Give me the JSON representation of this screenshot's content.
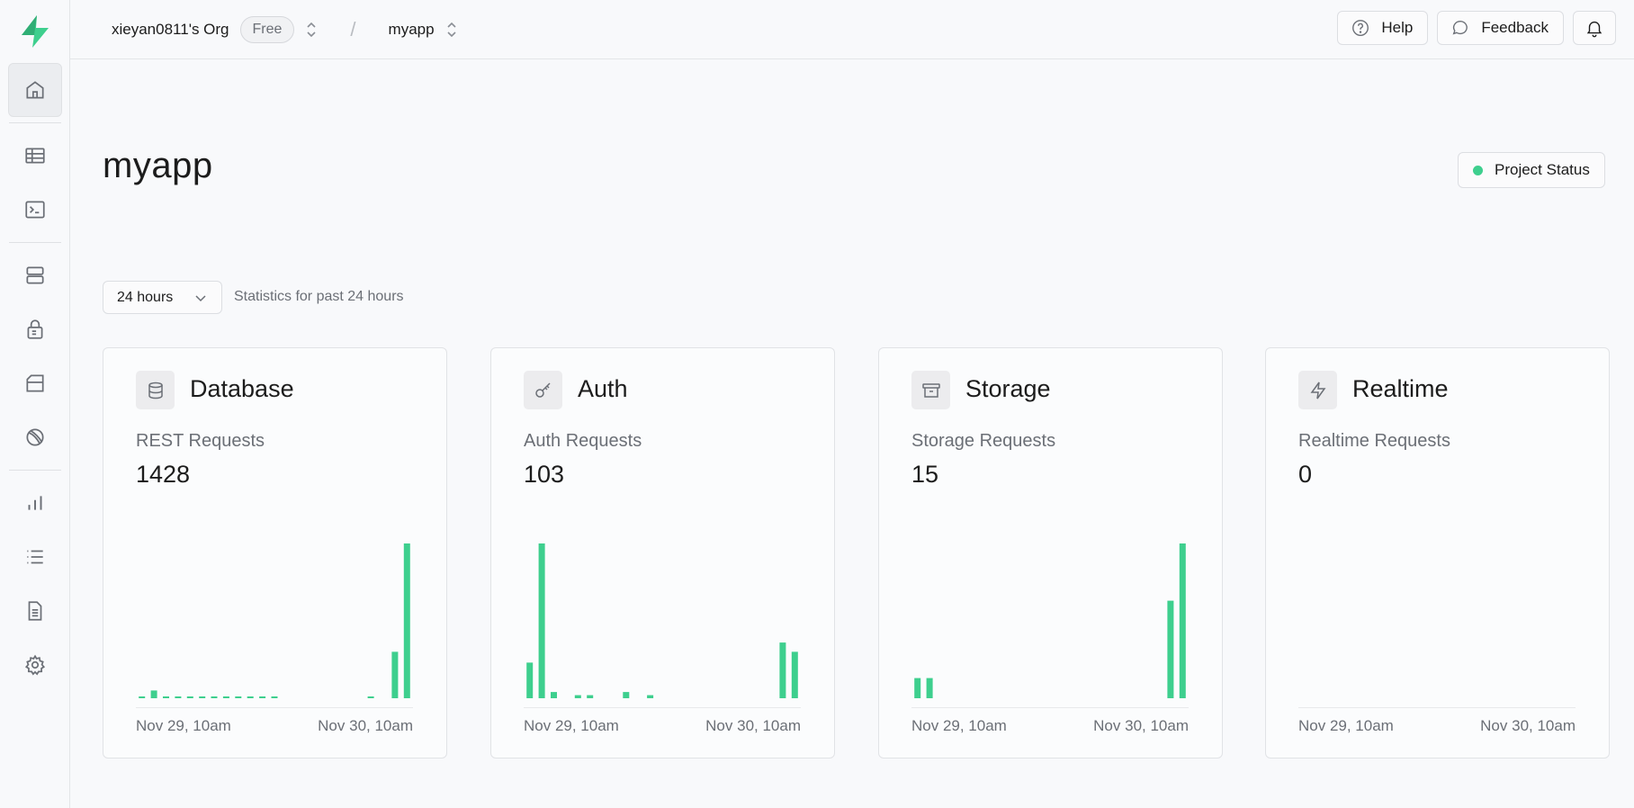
{
  "topbar": {
    "org_name": "xieyan0811's Org",
    "plan_badge": "Free",
    "project_name": "myapp",
    "help_label": "Help",
    "feedback_label": "Feedback"
  },
  "main": {
    "title": "myapp",
    "project_status_label": "Project Status",
    "range_select": "24 hours",
    "range_description": "Statistics for past 24 hours"
  },
  "colors": {
    "accent": "#3ecf8e",
    "bar": "#3ecf8e"
  },
  "sidebar": {
    "items": [
      {
        "name": "home-icon"
      },
      {
        "name": "table-editor-icon"
      },
      {
        "name": "sql-editor-icon"
      },
      {
        "name": "database-icon"
      },
      {
        "name": "auth-lock-icon"
      },
      {
        "name": "storage-icon"
      },
      {
        "name": "realtime-icon"
      },
      {
        "name": "reports-icon"
      },
      {
        "name": "logs-icon"
      },
      {
        "name": "docs-icon"
      },
      {
        "name": "settings-icon"
      }
    ]
  },
  "cards": [
    {
      "title": "Database",
      "label": "REST Requests",
      "value": "1428",
      "icon": "database-icon",
      "x_start": "Nov 29, 10am",
      "x_end": "Nov 30, 10am"
    },
    {
      "title": "Auth",
      "label": "Auth Requests",
      "value": "103",
      "icon": "key-icon",
      "x_start": "Nov 29, 10am",
      "x_end": "Nov 30, 10am"
    },
    {
      "title": "Storage",
      "label": "Storage Requests",
      "value": "15",
      "icon": "archive-icon",
      "x_start": "Nov 29, 10am",
      "x_end": "Nov 30, 10am"
    },
    {
      "title": "Realtime",
      "label": "Realtime Requests",
      "value": "0",
      "icon": "bolt-icon",
      "x_start": "Nov 29, 10am",
      "x_end": "Nov 30, 10am"
    }
  ],
  "chart_data": [
    {
      "type": "bar",
      "name": "REST Requests",
      "ylim": [
        0,
        1
      ],
      "values": [
        0.01,
        0.05,
        0.005,
        0.005,
        0.005,
        0.005,
        0.005,
        0.005,
        0.005,
        0.005,
        0.005,
        0.005,
        0,
        0,
        0,
        0,
        0,
        0,
        0,
        0.005,
        0,
        0.3,
        1.0
      ]
    },
    {
      "type": "bar",
      "name": "Auth Requests",
      "ylim": [
        0,
        1
      ],
      "values": [
        0.23,
        1.0,
        0.04,
        0,
        0.02,
        0.02,
        0,
        0,
        0.04,
        0,
        0.02,
        0,
        0,
        0,
        0,
        0,
        0,
        0,
        0,
        0,
        0,
        0.36,
        0.3
      ]
    },
    {
      "type": "bar",
      "name": "Storage Requests",
      "ylim": [
        0,
        1
      ],
      "values": [
        0.13,
        0.13,
        0,
        0,
        0,
        0,
        0,
        0,
        0,
        0,
        0,
        0,
        0,
        0,
        0,
        0,
        0,
        0,
        0,
        0,
        0,
        0.63,
        1.0
      ]
    },
    {
      "type": "bar",
      "name": "Realtime Requests",
      "ylim": [
        0,
        1
      ],
      "values": [
        0,
        0,
        0,
        0,
        0,
        0,
        0,
        0,
        0,
        0,
        0,
        0,
        0,
        0,
        0,
        0,
        0,
        0,
        0,
        0,
        0,
        0,
        0
      ]
    }
  ]
}
